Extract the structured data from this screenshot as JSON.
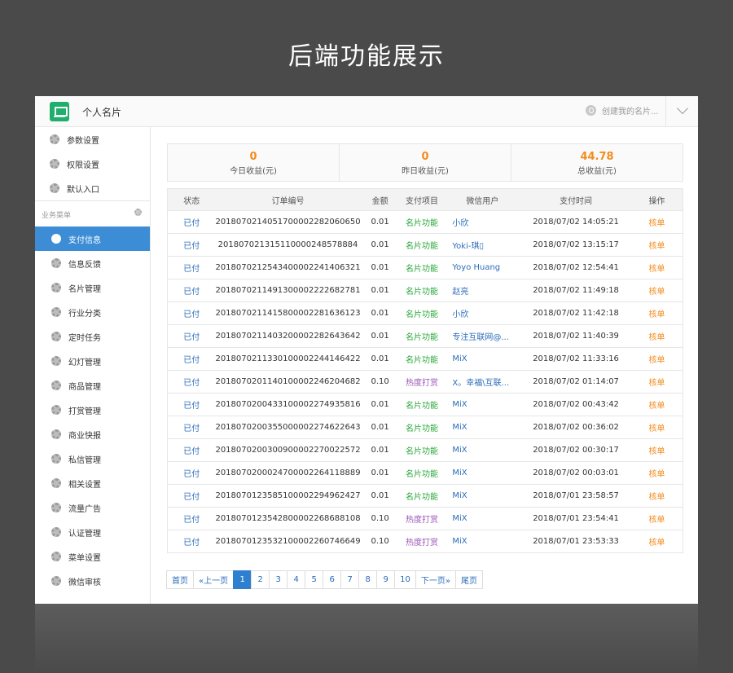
{
  "showcase_title": "后端功能展示",
  "header": {
    "app_title": "个人名片",
    "create_link": "创建我的名片..."
  },
  "sidebar": {
    "top_items": [
      "参数设置",
      "权限设置",
      "默认入口"
    ],
    "group_label": "业务菜单",
    "items": [
      "支付信息",
      "信息反馈",
      "名片管理",
      "行业分类",
      "定时任务",
      "幻灯管理",
      "商品管理",
      "打赏管理",
      "商业快报",
      "私信管理",
      "相关设置",
      "流量广告",
      "认证管理",
      "菜单设置",
      "微信审核"
    ],
    "active_index": 0
  },
  "stats": [
    {
      "value": "0",
      "label": "今日收益(元)"
    },
    {
      "value": "0",
      "label": "昨日收益(元)"
    },
    {
      "value": "44.78",
      "label": "总收益(元)"
    }
  ],
  "table": {
    "headers": [
      "状态",
      "订单编号",
      "金额",
      "支付项目",
      "微信用户",
      "支付时间",
      "操作"
    ],
    "rows": [
      {
        "status": "已付",
        "order": "20180702140517000022820606 50",
        "amount": "0.01",
        "item": "名片功能",
        "user": "小欣",
        "time": "2018/07/02 14:05:21",
        "op": "核单"
      },
      {
        "status": "已付",
        "order": "201807021315110000248578884",
        "amount": "0.01",
        "item": "名片功能",
        "user": "Yoki-琪▯",
        "time": "2018/07/02 13:15:17",
        "op": "核单"
      },
      {
        "status": "已付",
        "order": "201807021254340000224140632 1",
        "amount": "0.01",
        "item": "名片功能",
        "user": "Yoyo Huang",
        "time": "2018/07/02 12:54:41",
        "op": "核单"
      },
      {
        "status": "已付",
        "order": "201807021149130000222268278 1",
        "amount": "0.01",
        "item": "名片功能",
        "user": "赵亮",
        "time": "2018/07/02 11:49:18",
        "op": "核单"
      },
      {
        "status": "已付",
        "order": "201807021141580000228163612 3",
        "amount": "0.01",
        "item": "名片功能",
        "user": "小欣",
        "time": "2018/07/02 11:42:18",
        "op": "核单"
      },
      {
        "status": "已付",
        "order": "201807021140320000228264364 2",
        "amount": "0.01",
        "item": "名片功能",
        "user": "专注互联网@...",
        "time": "2018/07/02 11:40:39",
        "op": "核单"
      },
      {
        "status": "已付",
        "order": "201807021133010000224414642 2",
        "amount": "0.01",
        "item": "名片功能",
        "user": "MiX",
        "time": "2018/07/02 11:33:16",
        "op": "核单"
      },
      {
        "status": "已付",
        "order": "201807020114010000224620468 2",
        "amount": "0.10",
        "item": "热度打赏",
        "user": "X。幸福\\互联...",
        "time": "2018/07/02 01:14:07",
        "op": "核单"
      },
      {
        "status": "已付",
        "order": "201807020043310000227493581 6",
        "amount": "0.01",
        "item": "名片功能",
        "user": "MiX",
        "time": "2018/07/02 00:43:42",
        "op": "核单"
      },
      {
        "status": "已付",
        "order": "201807020035500000227462264 3",
        "amount": "0.01",
        "item": "名片功能",
        "user": "MiX",
        "time": "2018/07/02 00:36:02",
        "op": "核单"
      },
      {
        "status": "已付",
        "order": "201807020030090000227002257 2",
        "amount": "0.01",
        "item": "名片功能",
        "user": "MiX",
        "time": "2018/07/02 00:30:17",
        "op": "核单"
      },
      {
        "status": "已付",
        "order": "201807020002470000226411888 9",
        "amount": "0.01",
        "item": "名片功能",
        "user": "MiX",
        "time": "2018/07/02 00:03:01",
        "op": "核单"
      },
      {
        "status": "已付",
        "order": "201807012358510000229496242 7",
        "amount": "0.01",
        "item": "名片功能",
        "user": "MiX",
        "time": "2018/07/01 23:58:57",
        "op": "核单"
      },
      {
        "status": "已付",
        "order": "201807012354280000226868810 8",
        "amount": "0.10",
        "item": "热度打赏",
        "user": "MiX",
        "time": "2018/07/01 23:54:41",
        "op": "核单"
      },
      {
        "status": "已付",
        "order": "201807012353210000226074664 9",
        "amount": "0.10",
        "item": "热度打赏",
        "user": "MiX",
        "time": "2018/07/01 23:53:33",
        "op": "核单"
      }
    ]
  },
  "pager": {
    "items": [
      "首页",
      "«上一页",
      "1",
      "2",
      "3",
      "4",
      "5",
      "6",
      "7",
      "8",
      "9",
      "10",
      "下一页»",
      "尾页"
    ],
    "active": "1"
  },
  "colors": {
    "accent": "#3c8dd6",
    "orange": "#f28c1e",
    "green": "#29a63a",
    "purple": "#9b59b6",
    "logo_green": "#1fae6b"
  }
}
